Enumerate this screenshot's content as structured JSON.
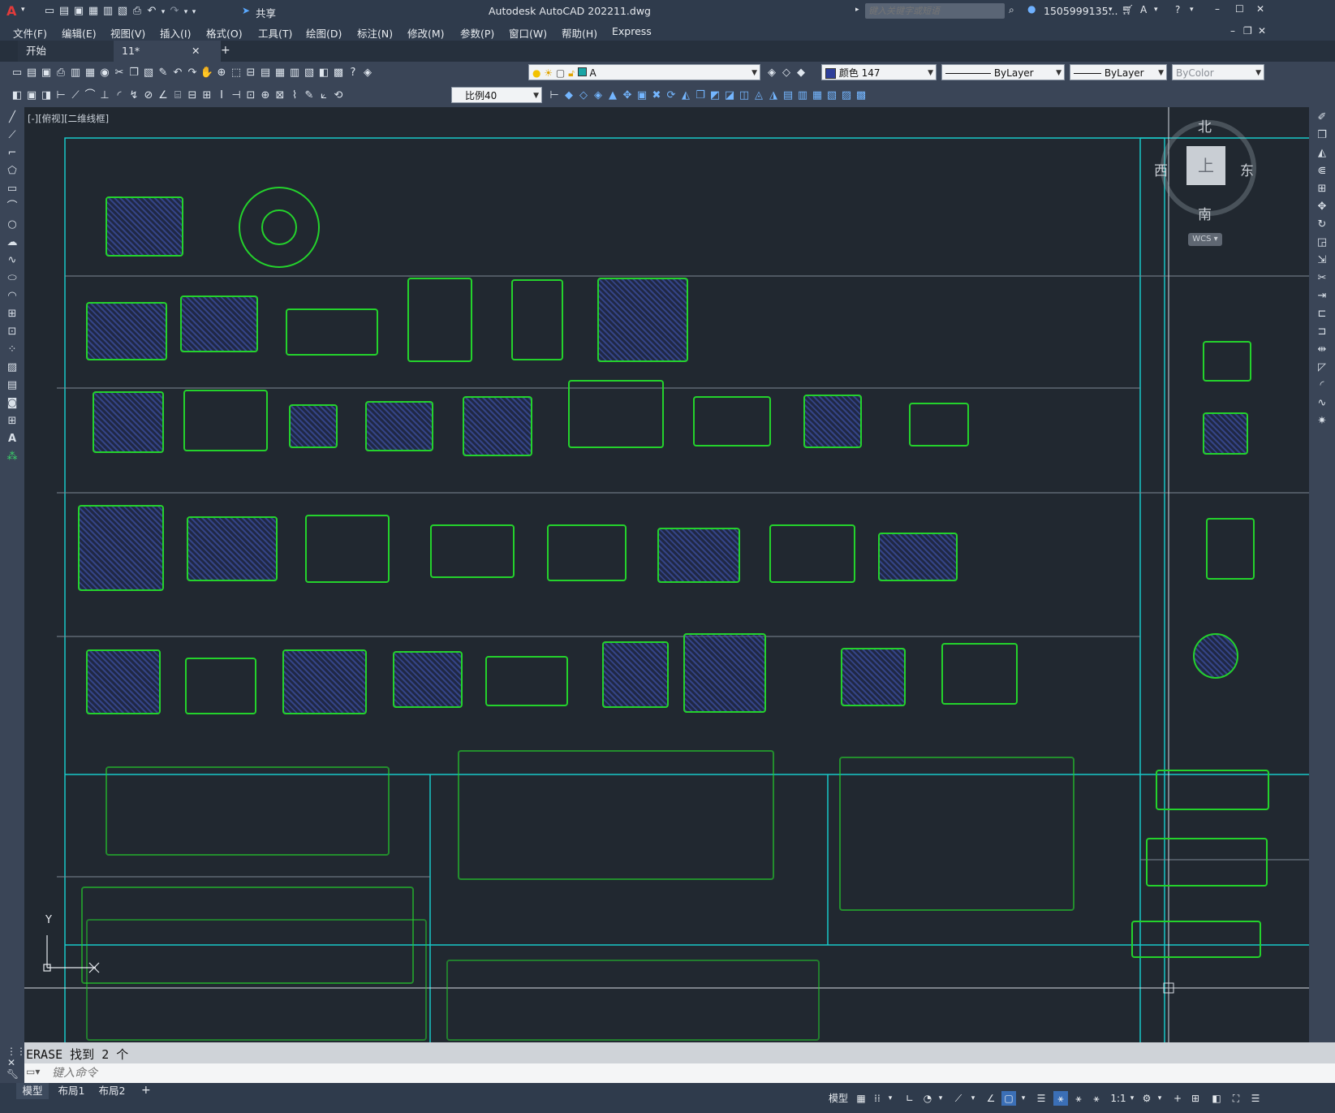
{
  "app": {
    "title": "Autodesk AutoCAD 2022",
    "filename": "11.dwg",
    "search_placeholder": "键入关键字或短语",
    "user": "1505999135...",
    "share": "共享"
  },
  "menu": [
    "文件(F)",
    "编辑(E)",
    "视图(V)",
    "插入(I)",
    "格式(O)",
    "工具(T)",
    "绘图(D)",
    "标注(N)",
    "修改(M)",
    "参数(P)",
    "窗口(W)",
    "帮助(H)",
    "Express"
  ],
  "tabs": [
    {
      "label": "开始"
    },
    {
      "label": "11*"
    }
  ],
  "toolbar": {
    "layer": "A",
    "color": "颜色 147",
    "linetype": "ByLayer",
    "lineweight": "ByLayer",
    "plotstyle": "ByColor",
    "scale": "比例40"
  },
  "viewport": {
    "label": "[-][俯视][二维线框]",
    "cube": {
      "north": "北",
      "south": "南",
      "east": "东",
      "west": "西",
      "top": "上",
      "wcs": "WCS"
    },
    "ucs_y": "Y"
  },
  "command": {
    "history": "ERASE  找到 2 个",
    "placeholder": "键入命令"
  },
  "layouts": [
    "模型",
    "布局1",
    "布局2"
  ],
  "status": {
    "model": "模型",
    "scale": "1:1"
  },
  "colors": {
    "canvas_bg": "#212830",
    "frame_cyan": "#19c7c7",
    "block_green": "#24d22c",
    "hatch_blue": "#2e3f9a"
  }
}
